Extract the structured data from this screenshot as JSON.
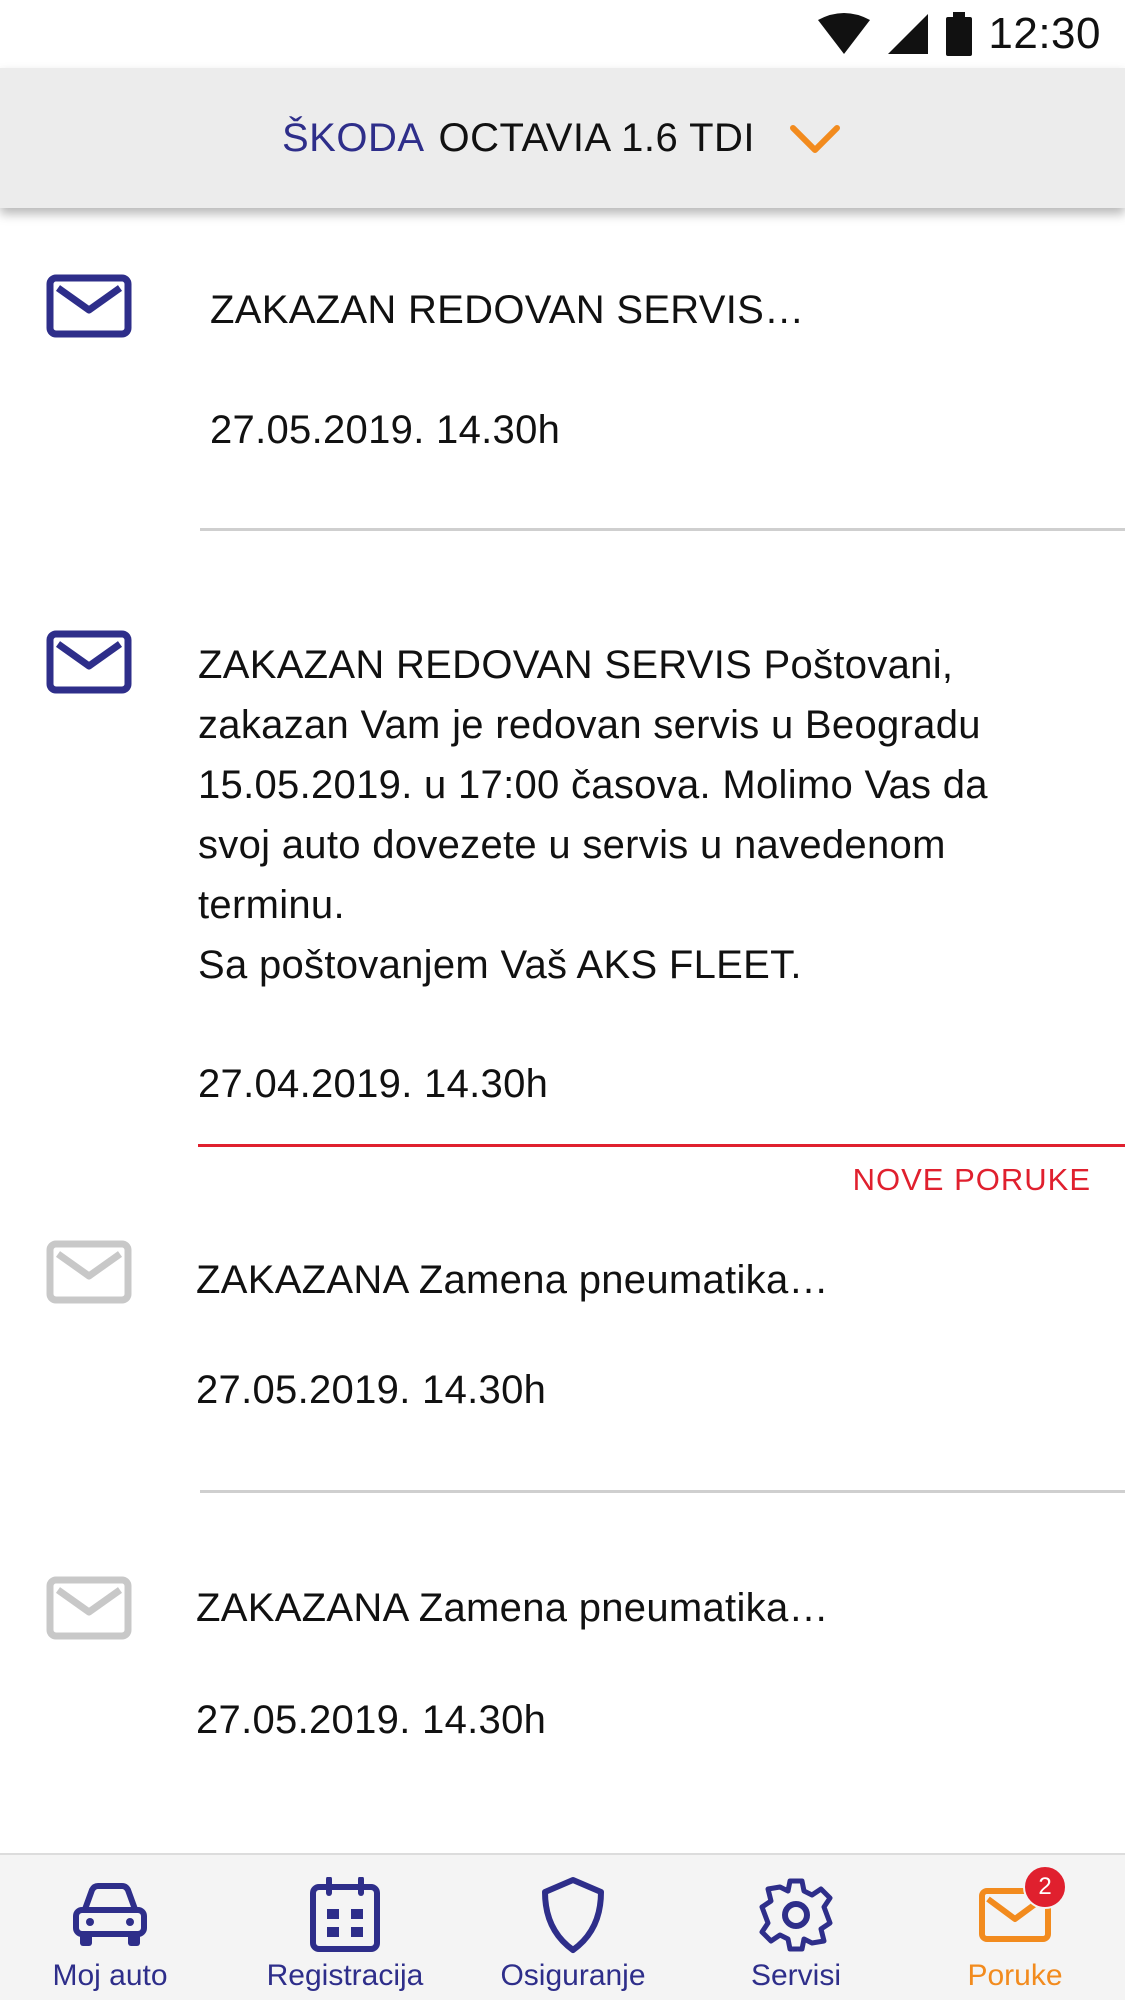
{
  "status_bar": {
    "time": "12:30",
    "icons": [
      "wifi-icon",
      "signal-icon",
      "battery-icon"
    ]
  },
  "header": {
    "brand": "ŠKODA",
    "model": "OCTAVIA 1.6 TDI",
    "dropdown_icon": "chevron-down-icon"
  },
  "messages": [
    {
      "title": "ZAKAZAN REDOVAN SERVIS…",
      "date": "27.05.2019. 14.30h",
      "read": false
    },
    {
      "title": "ZAKAZAN REDOVAN SERVIS Poštovani,",
      "body_lines": [
        "zakazan Vam je redovan servis u Beogradu",
        "15.05.2019. u 17:00 časova. Molimo Vas da",
        "svoj auto dovezete u servis u navedenom",
        "terminu.",
        "Sa poštovanjem Vaš AKS FLEET."
      ],
      "date": "27.04.2019. 14.30h",
      "read": false
    },
    {
      "title": "ZAKAZANA Zamena pneumatika…",
      "date": "27.05.2019. 14.30h",
      "read": true
    },
    {
      "title": "ZAKAZANA Zamena pneumatika…",
      "date": "27.05.2019. 14.30h",
      "read": true
    }
  ],
  "new_messages_label": "NOVE PORUKE",
  "bottom_nav": {
    "items": [
      {
        "label": "Moj auto",
        "icon": "car-icon"
      },
      {
        "label": "Registracija",
        "icon": "calendar-icon"
      },
      {
        "label": "Osiguranje",
        "icon": "shield-icon"
      },
      {
        "label": "Servisi",
        "icon": "gear-icon"
      },
      {
        "label": "Poruke",
        "icon": "mail-icon",
        "badge": "2",
        "active": true
      }
    ]
  },
  "colors": {
    "brand": "#2e2e8a",
    "accent": "#f28b1e",
    "alert": "#e0202e",
    "unread_icon": "#2e2e8a",
    "read_icon": "#c8c8c8"
  }
}
